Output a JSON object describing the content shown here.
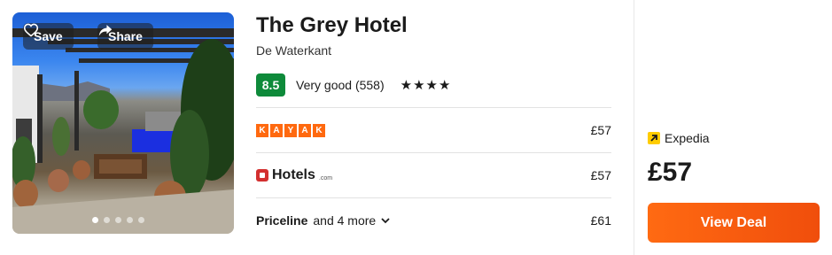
{
  "hotel": {
    "name": "The Grey Hotel",
    "location": "De Waterkant",
    "rating_score": "8.5",
    "rating_text": "Very good (558)",
    "stars": "★★★★",
    "star_count": 4
  },
  "photo": {
    "save_label": "Save",
    "share_label": "Share",
    "dot_count": 5,
    "active_dot": 0
  },
  "providers": [
    {
      "name": "KAYAK",
      "letters": [
        "K",
        "A",
        "Y",
        "A",
        "K"
      ],
      "price": "£57"
    },
    {
      "name": "Hotels",
      "suffix": ".com",
      "price": "£57"
    },
    {
      "name": "Priceline",
      "more": "and 4 more",
      "price": "£61"
    }
  ],
  "featured_deal": {
    "provider": "Expedia",
    "price": "£57",
    "button_label": "View Deal"
  },
  "colors": {
    "rating_badge": "#0e8a3a",
    "kayak": "#ff690f",
    "hotels": "#d32f2f",
    "expedia": "#ffcc00",
    "cta": "#ff5b0f"
  }
}
